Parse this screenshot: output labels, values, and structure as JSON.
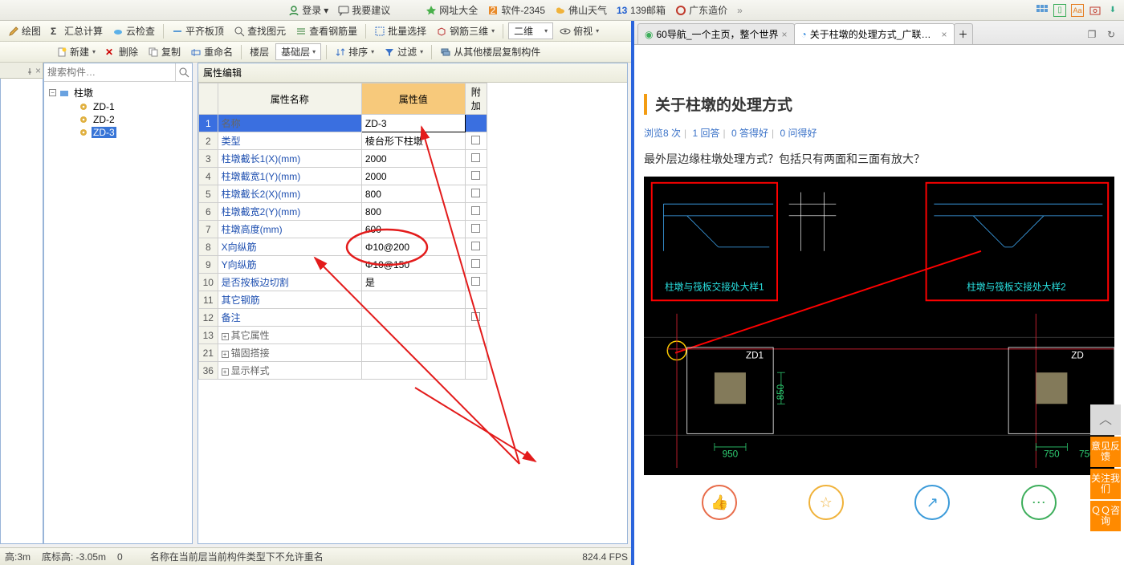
{
  "browser_bar": {
    "login": "登录",
    "login_drop": "▾",
    "feedback": "我要建议",
    "favs": [
      {
        "label": "网址大全",
        "color": "#49B04B"
      },
      {
        "label": "软件-2345",
        "color": "#E08A2A"
      },
      {
        "label": "佛山天气",
        "color": "#3C91E6"
      },
      {
        "label": "139邮箱",
        "color": "#1E5DD0"
      },
      {
        "label": "广东造价",
        "color": "#C0392B"
      }
    ],
    "more": "»"
  },
  "toolbar1": {
    "draw": "绘图",
    "sum": "汇总计算",
    "cloud": "云检查",
    "flat": "平齐板顶",
    "findg": "查找图元",
    "steel": "查看钢筋量",
    "batch": "批量选择",
    "steel3d": "钢筋三维",
    "twod": "二维",
    "bird": "俯视"
  },
  "toolbar2": {
    "new": "新建",
    "del": "删除",
    "copy": "复制",
    "rename": "重命名",
    "floor": "楼层",
    "base": "基础层",
    "sort": "排序",
    "filter": "过滤",
    "copyfrom": "从其他楼层复制构件"
  },
  "tree": {
    "search_ph": "搜索构件…",
    "root": "柱墩",
    "items": [
      "ZD-1",
      "ZD-2",
      "ZD-3"
    ],
    "selected": 2
  },
  "prop": {
    "title": "属性编辑",
    "headers": {
      "name": "属性名称",
      "value": "属性值",
      "extra": "附加"
    },
    "rows": [
      {
        "n": "1",
        "attr": "名称",
        "val": "ZD-3",
        "chk": false,
        "sel": true,
        "blue": false
      },
      {
        "n": "2",
        "attr": "类型",
        "val": "棱台形下柱墩",
        "chk": true,
        "blue": true
      },
      {
        "n": "3",
        "attr": "柱墩截长1(X)(mm)",
        "val": "2000",
        "chk": true,
        "blue": true
      },
      {
        "n": "4",
        "attr": "柱墩截宽1(Y)(mm)",
        "val": "2000",
        "chk": true,
        "blue": true
      },
      {
        "n": "5",
        "attr": "柱墩截长2(X)(mm)",
        "val": "800",
        "chk": true,
        "blue": true
      },
      {
        "n": "6",
        "attr": "柱墩截宽2(Y)(mm)",
        "val": "800",
        "chk": true,
        "blue": true
      },
      {
        "n": "7",
        "attr": "柱墩高度(mm)",
        "val": "600",
        "chk": true,
        "blue": true
      },
      {
        "n": "8",
        "attr": "X向纵筋",
        "val": "Φ10@200",
        "chk": true,
        "blue": true
      },
      {
        "n": "9",
        "attr": "Y向纵筋",
        "val": "Φ10@150",
        "chk": true,
        "blue": true
      },
      {
        "n": "10",
        "attr": "是否按板边切割",
        "val": "是",
        "chk": true,
        "blue": true
      },
      {
        "n": "11",
        "attr": "其它钢筋",
        "val": "",
        "chk": false,
        "blue": true
      },
      {
        "n": "12",
        "attr": "备注",
        "val": "",
        "chk": true,
        "blue": true
      },
      {
        "n": "13",
        "attr": "其它属性",
        "val": "",
        "chk": false,
        "exp": true,
        "blue": false
      },
      {
        "n": "21",
        "attr": "锚固搭接",
        "val": "",
        "chk": false,
        "exp": true,
        "blue": false
      },
      {
        "n": "36",
        "attr": "显示样式",
        "val": "",
        "chk": false,
        "exp": true,
        "blue": false
      }
    ]
  },
  "status": {
    "h": "高:3m",
    "bot": "底标高: -3.05m",
    "zero": "0",
    "msg": "名称在当前层当前构件类型下不允许重名",
    "fps": "824.4 FPS"
  },
  "tabs": [
    {
      "title": "60导航_一个主页，整个世界",
      "active": false
    },
    {
      "title": "关于柱墩的处理方式_广联达服务",
      "active": true
    }
  ],
  "page": {
    "title": "关于柱墩的处理方式",
    "meta": {
      "views": "浏览8 次",
      "answers": "1 回答",
      "good": "0 答得好",
      "ask": "0 问得好"
    },
    "question": "最外层边缘柱墩处理方式？包括只有两面和三面有放大？",
    "cad": {
      "box1_label": "柱墩与筏板交接处大样1",
      "box2_label": "柱墩与筏板交接处大样2",
      "zd1": "ZD1",
      "zd_r": "ZD",
      "dim_950": "950",
      "dim_850": "850",
      "dim_750": "750"
    }
  },
  "side": {
    "top": "︿",
    "b1": "意见反馈",
    "b2": "关注我们",
    "b3": "ＱＱ咨询"
  }
}
